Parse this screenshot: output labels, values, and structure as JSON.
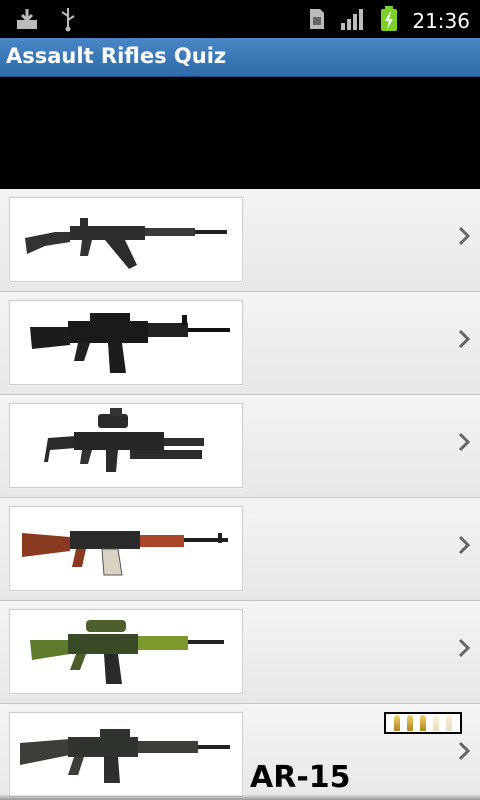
{
  "status_bar": {
    "time": "21:36",
    "left_icons": [
      "download-icon",
      "usb-icon"
    ],
    "right_icons": [
      "sim-card-icon",
      "signal-icon",
      "battery-charging-icon"
    ]
  },
  "app": {
    "title": "Assault Rifles Quiz"
  },
  "list": {
    "items": [
      {
        "image": "rifle-thumbnail-1",
        "chevron": "chevron-right-icon"
      },
      {
        "image": "rifle-thumbnail-2",
        "chevron": "chevron-right-icon"
      },
      {
        "image": "rifle-thumbnail-3",
        "chevron": "chevron-right-icon"
      },
      {
        "image": "rifle-thumbnail-4",
        "chevron": "chevron-right-icon"
      },
      {
        "image": "rifle-thumbnail-5",
        "chevron": "chevron-right-icon"
      },
      {
        "image": "rifle-thumbnail-6",
        "chevron": "chevron-right-icon",
        "answer": "AR-15",
        "ammo": {
          "filled": 3,
          "total": 5
        }
      }
    ]
  },
  "colors": {
    "title_bar": "#3a78b9",
    "status_bar": "#000000",
    "ad_banner": "#000000"
  }
}
